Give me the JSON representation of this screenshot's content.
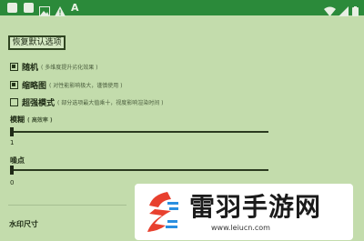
{
  "status_bar": {
    "icons": [
      "app-icon-1",
      "app-icon-2",
      "image-icon",
      "warning-icon",
      "text-a-icon",
      "wifi-icon",
      "signal-icon",
      "battery-icon"
    ],
    "a_glyph": "A"
  },
  "settings": {
    "reset_button": "恢复默认选项",
    "options": [
      {
        "label": "随机",
        "hint": "( 多维度提升劣化效果 )",
        "checked": true
      },
      {
        "label": "缩略图",
        "hint": "( 对性能影响极大，谨慎使用 )",
        "checked": true
      },
      {
        "label": "超强模式",
        "hint": "( 部分选项最大值乘十，视度影响渲染时间 )",
        "checked": false
      }
    ],
    "blur": {
      "label": "模糊",
      "hint": "( 高效率 )",
      "value": "1",
      "level": 0.0
    },
    "noise": {
      "label": "噪点",
      "value": "0",
      "level": 0.0
    },
    "watermark_size": "水印尺寸"
  },
  "watermark": {
    "text": "雷羽手游网",
    "url": "www.leiucn.com"
  }
}
